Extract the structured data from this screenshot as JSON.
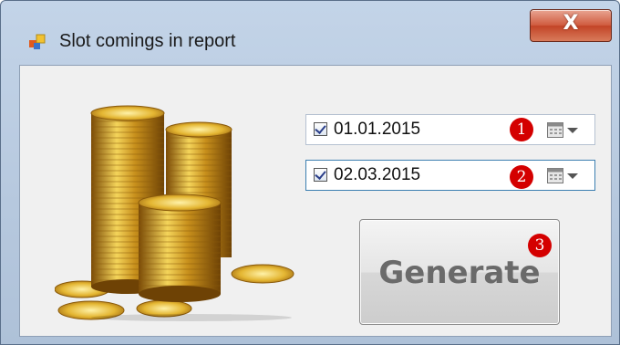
{
  "window": {
    "title": "Slot comings in report",
    "close_label": "X"
  },
  "date_pickers": [
    {
      "value": "01.01.2015",
      "checked": true,
      "badge": "1"
    },
    {
      "value": "02.03.2015",
      "checked": true,
      "badge": "2"
    }
  ],
  "generate": {
    "label": "Generate",
    "badge": "3"
  },
  "icons": {
    "app": "app-window-icon",
    "coins": "gold-coins-illustration",
    "calendar": "calendar-icon"
  }
}
